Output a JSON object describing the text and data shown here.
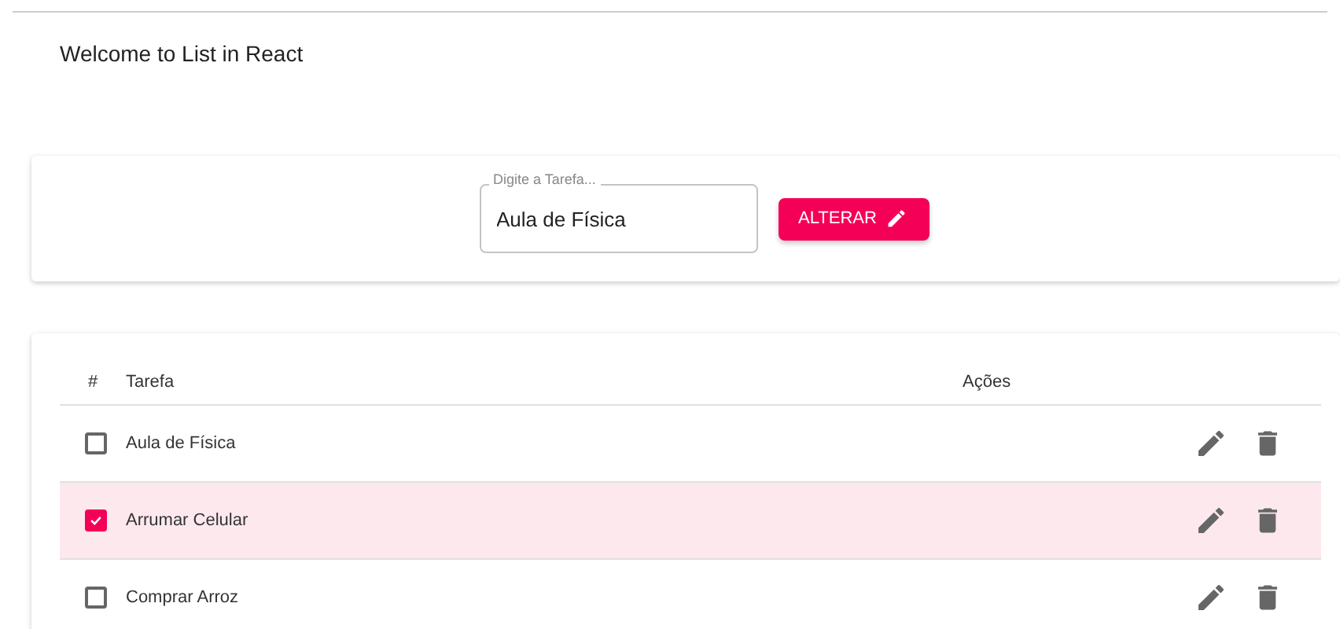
{
  "welcome": "Welcome to List in React",
  "form": {
    "label": "Digite a Tarefa...",
    "value": "Aula de Física",
    "button": "ALTERAR"
  },
  "table": {
    "columns": [
      "#",
      "Tarefa",
      "Ações"
    ],
    "rows": [
      {
        "task": "Aula de Física",
        "checked": false
      },
      {
        "task": "Arrumar Celular",
        "checked": true
      },
      {
        "task": "Comprar Arroz",
        "checked": false
      }
    ]
  }
}
